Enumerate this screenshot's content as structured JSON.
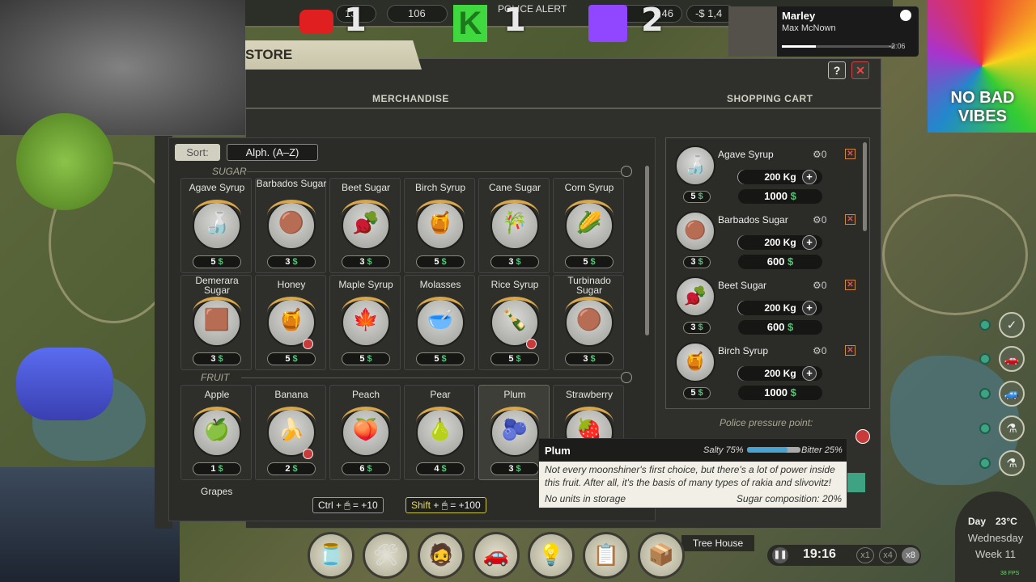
{
  "hud": {
    "counter_left": "13",
    "bulbs": "106",
    "police_alert": "POLICE ALERT",
    "money_partial": "9,46",
    "money_right": "-$ 1,4"
  },
  "overlay": {
    "youtube_count": "1",
    "kick_count": "1",
    "twitch_count": "2",
    "kick_letter": "K",
    "spotify_title": "Marley",
    "spotify_artist": "Max McNown",
    "spotify_time": "-2:06",
    "logo_text": "NO BAD VIBES"
  },
  "store": {
    "title": "STORE",
    "help_label": "?",
    "close_label": "✕",
    "merch_header": "MERCHANDISE",
    "cart_header": "SHOPPING CART",
    "sort_label": "Sort:",
    "sort_value": "Alph. (A–Z)",
    "category_sugar": "SUGAR",
    "category_fruit": "FRUIT",
    "sugar_items": [
      {
        "name": "Agave Syrup",
        "price": "5",
        "icon": "agave-bottle-icon",
        "glyph": "🍶"
      },
      {
        "name": "Barbados Sugar",
        "price": "3",
        "icon": "brown-sugar-icon",
        "glyph": "🟤"
      },
      {
        "name": "Beet Sugar",
        "price": "3",
        "icon": "beet-icon",
        "glyph": "🫜"
      },
      {
        "name": "Birch Syrup",
        "price": "5",
        "icon": "syrup-bottle-icon",
        "glyph": "🍯"
      },
      {
        "name": "Cane Sugar",
        "price": "3",
        "icon": "sugar-cane-icon",
        "glyph": "🎋"
      },
      {
        "name": "Corn Syrup",
        "price": "5",
        "icon": "corn-icon",
        "glyph": "🌽"
      },
      {
        "name": "Demerara Sugar",
        "price": "3",
        "icon": "demerara-sugar-icon",
        "glyph": "🟫"
      },
      {
        "name": "Honey",
        "price": "5",
        "icon": "honey-jar-icon",
        "glyph": "🍯"
      },
      {
        "name": "Maple Syrup",
        "price": "5",
        "icon": "maple-bottle-icon",
        "glyph": "🍁"
      },
      {
        "name": "Molasses",
        "price": "5",
        "icon": "molasses-bowl-icon",
        "glyph": "🥣"
      },
      {
        "name": "Rice Syrup",
        "price": "5",
        "icon": "rice-syrup-bottle-icon",
        "glyph": "🍾"
      },
      {
        "name": "Turbinado Sugar",
        "price": "3",
        "icon": "turbinado-sugar-icon",
        "glyph": "🟤"
      }
    ],
    "fruit_items": [
      {
        "name": "Apple",
        "price": "1",
        "icon": "apple-icon",
        "glyph": "🍏"
      },
      {
        "name": "Banana",
        "price": "2",
        "icon": "banana-icon",
        "glyph": "🍌"
      },
      {
        "name": "Peach",
        "price": "6",
        "icon": "peach-icon",
        "glyph": "🍑"
      },
      {
        "name": "Pear",
        "price": "4",
        "icon": "pear-icon",
        "glyph": "🍐"
      },
      {
        "name": "Plum",
        "price": "3",
        "icon": "plum-icon",
        "glyph": "🫐"
      },
      {
        "name": "Strawberry",
        "price": "",
        "icon": "strawberry-icon",
        "glyph": "🍓"
      }
    ],
    "next_row_label": "Grapes",
    "cart": [
      {
        "name": "Agave Syrup",
        "count": "0",
        "qty": "200 Kg",
        "total": "1000",
        "price": "5",
        "glyph": "🍶"
      },
      {
        "name": "Barbados Sugar",
        "count": "0",
        "qty": "200 Kg",
        "total": "600",
        "price": "3",
        "glyph": "🟤"
      },
      {
        "name": "Beet Sugar",
        "count": "0",
        "qty": "200 Kg",
        "total": "600",
        "price": "3",
        "glyph": "🫜"
      },
      {
        "name": "Birch Syrup",
        "count": "0",
        "qty": "200 Kg",
        "total": "1000",
        "price": "5",
        "glyph": "🍯"
      }
    ],
    "police_pressure": "Police pressure point:",
    "ctrl_hint": {
      "key": "Ctrl",
      "plus": "+",
      "value": "= +10"
    },
    "shift_hint": {
      "key": "Shift",
      "plus": "+",
      "value": "= +100"
    }
  },
  "tooltip": {
    "title": "Plum",
    "salty": "Salty 75%",
    "bitter": "Bitter 25%",
    "salty_ratio": 0.75,
    "description": "Not every moonshiner's first choice, but there's a lot of power inside this fruit. After all, it's the basis of many types of rakia and slivovitz!",
    "storage": "No units in storage",
    "sugar_comp": "Sugar composition: 20%"
  },
  "bottom": {
    "location": "Tree House",
    "time": "19:16",
    "speed1": "x1",
    "speed4": "x4",
    "speed8": "x8",
    "fps": "38 FPS",
    "day_label": "Day",
    "temp": "23°C",
    "weekday": "Wednesday",
    "week": "Week 11"
  },
  "dock_icons": [
    "jug-icon",
    "tools-icon",
    "character-icon",
    "car-icon",
    "lightbulb-icon",
    "notes-icon",
    "crate-icon"
  ],
  "colors": {
    "accent_green": "#5bc07a",
    "alert_red": "#c93b3b",
    "panel": "#2f2f2b"
  }
}
